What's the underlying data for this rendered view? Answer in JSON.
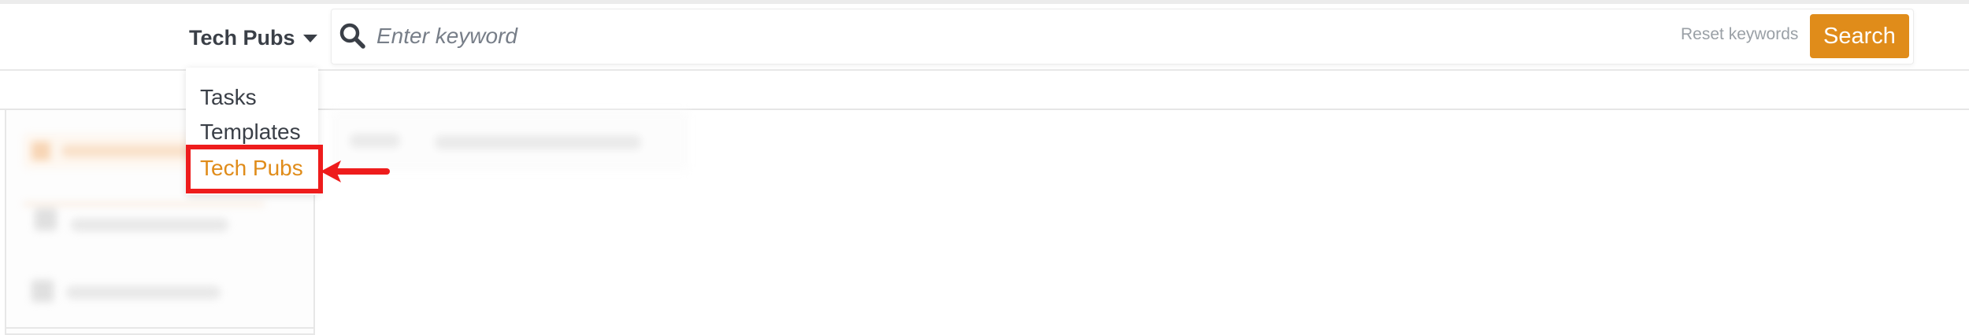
{
  "header": {
    "scope_label": "Tech Pubs",
    "search": {
      "placeholder": "Enter keyword",
      "value": ""
    },
    "reset_label": "Reset keywords",
    "search_button_label": "Search"
  },
  "dropdown": {
    "items": [
      {
        "label": "Tasks",
        "selected": false
      },
      {
        "label": "Templates",
        "selected": false
      },
      {
        "label": "Tech Pubs",
        "selected": true
      }
    ]
  },
  "colors": {
    "accent": "#e08c1a",
    "annotation": "#ee1c1c",
    "text": "#3a3f47"
  }
}
